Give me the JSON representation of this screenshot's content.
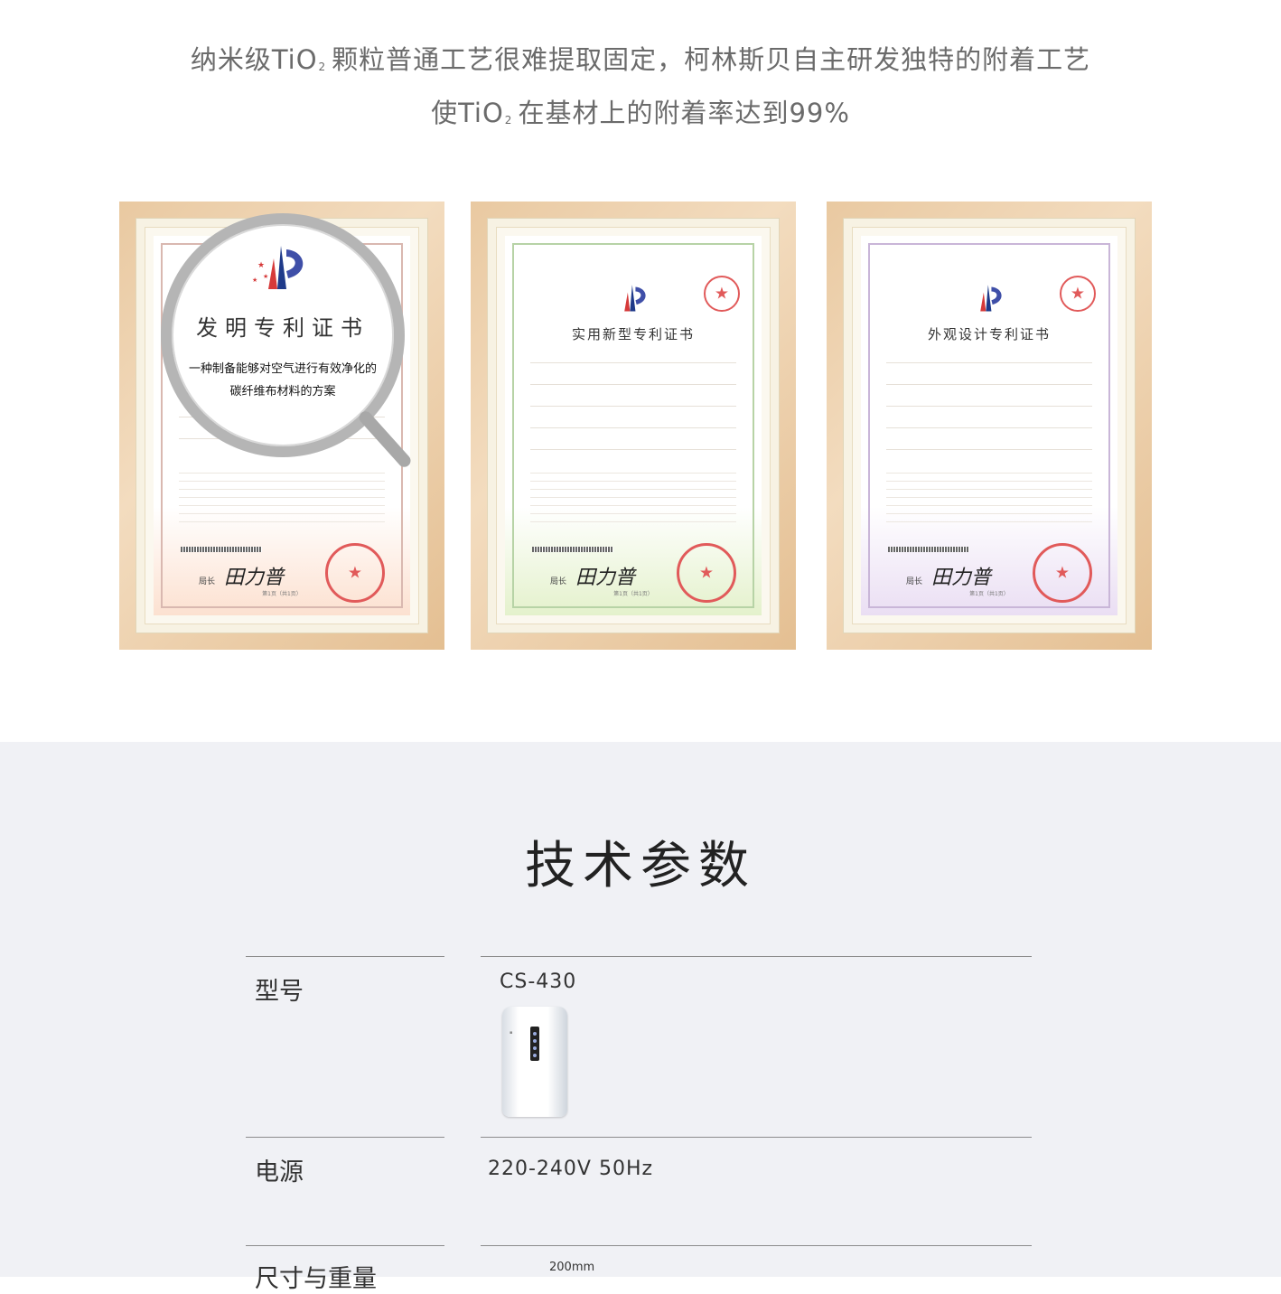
{
  "intro": {
    "line1_a": "纳米级TiO",
    "line1_sub": "2",
    "line1_b": "颗粒普通工艺很难提取固定，柯林斯贝自主研发独特的附着工艺",
    "line2_a": "使TiO",
    "line2_sub": "2",
    "line2_b": "在基材上的附着率达到99%"
  },
  "certificates": [
    {
      "title": "发明专利证书",
      "magnified_description_1": "一种制备能够对空气进行有效净化的",
      "magnified_description_2": "碳纤维布材料的方案",
      "sign_label": "局长",
      "signature": "田力普",
      "page": "第1页（共1页）"
    },
    {
      "title": "实用新型专利证书",
      "sign_label": "局长",
      "signature": "田力普",
      "page": "第1页（共1页）"
    },
    {
      "title": "外观设计专利证书",
      "sign_label": "局长",
      "signature": "田力普",
      "page": "第1页（共1页）"
    }
  ],
  "specs": {
    "title": "技术参数",
    "rows": [
      {
        "label": "型号",
        "value": "CS-430"
      },
      {
        "label": "电源",
        "value": "220-240V 50Hz"
      },
      {
        "label": "尺寸与重量",
        "value": "200mm"
      }
    ]
  },
  "colors": {
    "frame": "#e9c9a1",
    "seal": "#e15a5a",
    "specs_bg": "#f0f1f5"
  }
}
